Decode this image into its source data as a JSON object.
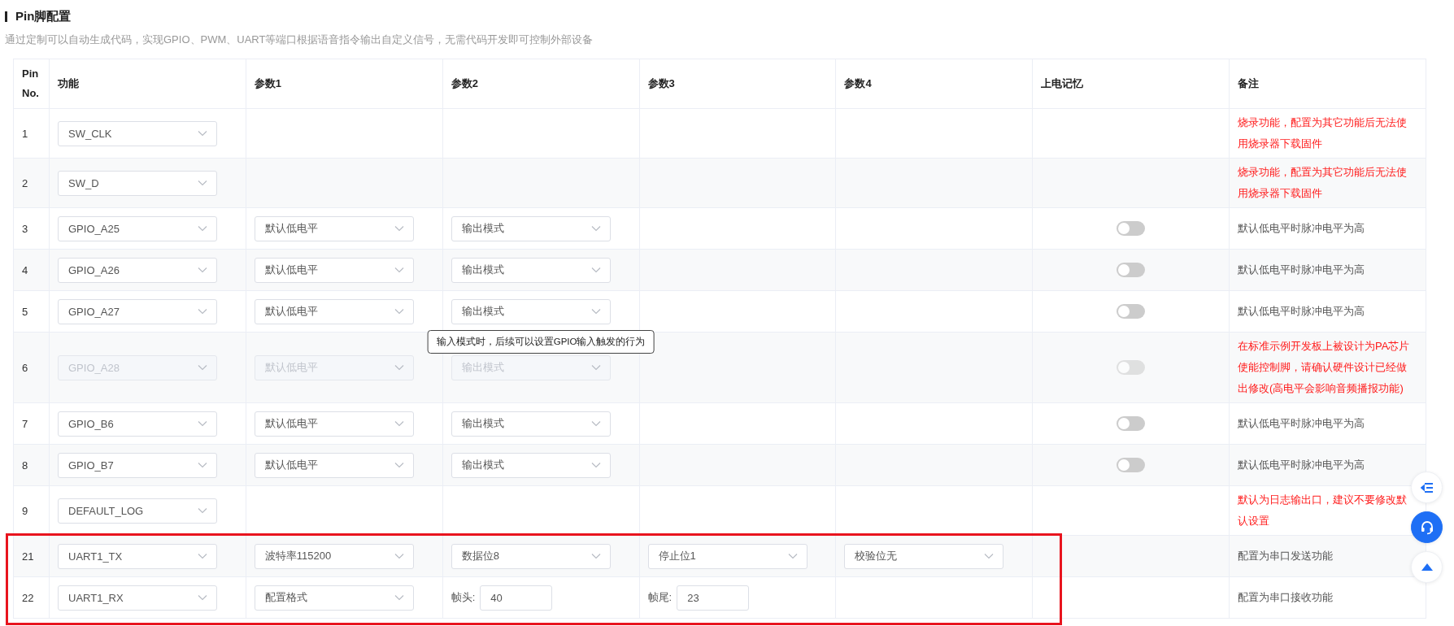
{
  "section": {
    "title": "Pin脚配置",
    "description": "通过定制可以自动生成代码，实现GPIO、PWM、UART等端口根据语音指令输出自定义信号，无需代码开发即可控制外部设备"
  },
  "table": {
    "columns": [
      "Pin No.",
      "功能",
      "参数1",
      "参数2",
      "参数3",
      "参数4",
      "上电记忆",
      "备注"
    ],
    "rows": [
      {
        "pin": "1",
        "function": "SW_CLK",
        "disabled": false,
        "highlighted": false,
        "params": [],
        "note": {
          "text": "烧录功能，配置为其它功能后无法使用烧录器下载固件",
          "warning": true
        }
      },
      {
        "pin": "2",
        "function": "SW_D",
        "disabled": false,
        "highlighted": false,
        "params": [],
        "note": {
          "text": "烧录功能，配置为其它功能后无法使用烧录器下载固件",
          "warning": true
        }
      },
      {
        "pin": "3",
        "function": "GPIO_A25",
        "disabled": false,
        "highlighted": false,
        "params": [
          {
            "kind": "select",
            "value": "默认低电平"
          },
          {
            "kind": "select",
            "value": "输出模式"
          }
        ],
        "memory": {
          "on": false
        },
        "note": {
          "text": "默认低电平时脉冲电平为高",
          "warning": false
        }
      },
      {
        "pin": "4",
        "function": "GPIO_A26",
        "disabled": false,
        "highlighted": false,
        "params": [
          {
            "kind": "select",
            "value": "默认低电平"
          },
          {
            "kind": "select",
            "value": "输出模式"
          }
        ],
        "memory": {
          "on": false
        },
        "note": {
          "text": "默认低电平时脉冲电平为高",
          "warning": false
        }
      },
      {
        "pin": "5",
        "function": "GPIO_A27",
        "disabled": false,
        "highlighted": false,
        "params": [
          {
            "kind": "select",
            "value": "默认低电平"
          },
          {
            "kind": "select",
            "value": "输出模式"
          }
        ],
        "memory": {
          "on": false
        },
        "note": {
          "text": "默认低电平时脉冲电平为高",
          "warning": false
        }
      },
      {
        "pin": "6",
        "function": "GPIO_A28",
        "disabled": true,
        "highlighted": false,
        "params": [
          {
            "kind": "select",
            "value": "默认低电平"
          },
          {
            "kind": "select",
            "value": "输出模式",
            "tooltip": "输入模式时，后续可以设置GPIO输入触发的行为"
          }
        ],
        "memory": {
          "on": false
        },
        "note": {
          "text": "在标准示例开发板上被设计为PA芯片使能控制脚，请确认硬件设计已经做出修改(高电平会影响音频播报功能)",
          "warning": true
        }
      },
      {
        "pin": "7",
        "function": "GPIO_B6",
        "disabled": false,
        "highlighted": false,
        "params": [
          {
            "kind": "select",
            "value": "默认低电平"
          },
          {
            "kind": "select",
            "value": "输出模式"
          }
        ],
        "memory": {
          "on": false
        },
        "note": {
          "text": "默认低电平时脉冲电平为高",
          "warning": false
        }
      },
      {
        "pin": "8",
        "function": "GPIO_B7",
        "disabled": false,
        "highlighted": false,
        "params": [
          {
            "kind": "select",
            "value": "默认低电平"
          },
          {
            "kind": "select",
            "value": "输出模式"
          }
        ],
        "memory": {
          "on": false
        },
        "note": {
          "text": "默认低电平时脉冲电平为高",
          "warning": false
        }
      },
      {
        "pin": "9",
        "function": "DEFAULT_LOG",
        "disabled": false,
        "highlighted": false,
        "params": [],
        "note": {
          "text": "默认为日志输出口，建议不要修改默认设置",
          "warning": true
        }
      },
      {
        "pin": "21",
        "function": "UART1_TX",
        "disabled": false,
        "highlighted": true,
        "params": [
          {
            "kind": "select",
            "value": "波特率115200"
          },
          {
            "kind": "select",
            "value": "数据位8"
          },
          {
            "kind": "select",
            "value": "停止位1"
          },
          {
            "kind": "select",
            "value": "校验位无"
          }
        ],
        "note": {
          "text": "配置为串口发送功能",
          "warning": false
        }
      },
      {
        "pin": "22",
        "function": "UART1_RX",
        "disabled": false,
        "highlighted": true,
        "params": [
          {
            "kind": "select",
            "value": "配置格式"
          },
          {
            "kind": "input",
            "label": "帧头:",
            "value": "40"
          },
          {
            "kind": "input",
            "label": "帧尾:",
            "value": "23"
          }
        ],
        "note": {
          "text": "配置为串口接收功能",
          "warning": false
        }
      }
    ]
  },
  "float_buttons": [
    {
      "kind": "menu"
    },
    {
      "kind": "support"
    },
    {
      "kind": "top"
    }
  ]
}
